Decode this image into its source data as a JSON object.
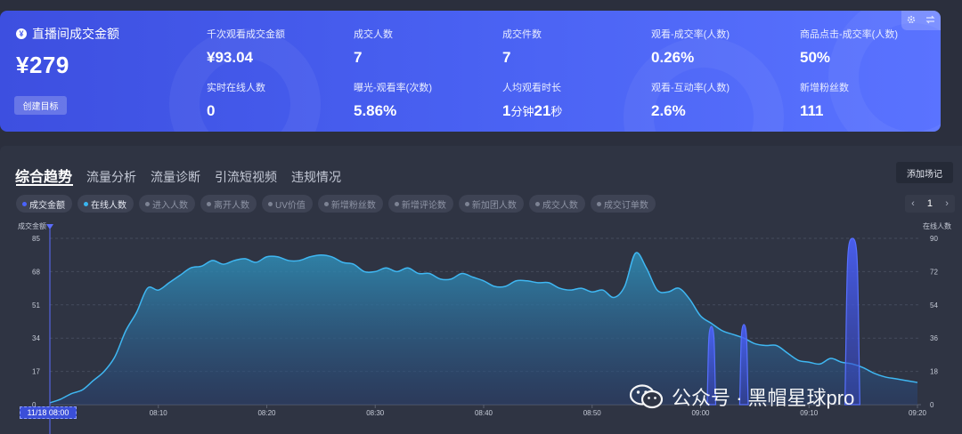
{
  "summary": {
    "main_label": "直播间成交金额",
    "main_badge": "¥",
    "main_value": "¥279",
    "goal_button": "创建目标",
    "stats": [
      {
        "label": "千次观看成交金额",
        "value": "¥93.04"
      },
      {
        "label": "成交人数",
        "value": "7"
      },
      {
        "label": "成交件数",
        "value": "7"
      },
      {
        "label": "观看-成交率(人数)",
        "value": "0.26%"
      },
      {
        "label": "商品点击-成交率(人数)",
        "value": "50%"
      },
      {
        "label": "实时在线人数",
        "value": "0"
      },
      {
        "label": "曝光-观看率(次数)",
        "value": "5.86%"
      },
      {
        "label": "人均观看时长",
        "value_parts": [
          "1",
          "分钟",
          "21",
          "秒"
        ]
      },
      {
        "label": "观看-互动率(人数)",
        "value": "2.6%"
      },
      {
        "label": "新增粉丝数",
        "value": "111"
      }
    ],
    "corner_icons": [
      "gear-icon",
      "swap-icon"
    ]
  },
  "tabs": [
    "综合趋势",
    "流量分析",
    "流量诊断",
    "引流短视频",
    "违规情况"
  ],
  "add_note_button": "添加场记",
  "chips": [
    {
      "label": "成交金额",
      "active": true,
      "color": "#4a63ff"
    },
    {
      "label": "在线人数",
      "active": true,
      "color": "#39b5f0"
    },
    {
      "label": "进入人数",
      "active": false
    },
    {
      "label": "离开人数",
      "active": false
    },
    {
      "label": "UV价值",
      "active": false
    },
    {
      "label": "新增粉丝数",
      "active": false
    },
    {
      "label": "新增评论数",
      "active": false
    },
    {
      "label": "新加团人数",
      "active": false
    },
    {
      "label": "成交人数",
      "active": false
    },
    {
      "label": "成交订单数",
      "active": false
    }
  ],
  "pager": {
    "prev": "‹",
    "page": "1",
    "next": "›"
  },
  "chart_data": {
    "type": "area",
    "left_axis_label": "成交金额",
    "right_axis_label": "在线人数",
    "left_ticks": [
      "85",
      "68",
      "51",
      "34",
      "17",
      "0"
    ],
    "right_ticks": [
      "90",
      "72",
      "54",
      "36",
      "18",
      "0"
    ],
    "ylim_left": [
      0,
      85
    ],
    "ylim_right": [
      0,
      90
    ],
    "x_ticks": [
      "08:10",
      "08:20",
      "08:30",
      "08:40",
      "08:50",
      "09:00",
      "09:10",
      "09:20"
    ],
    "start_label": "11/18 08:00",
    "series": [
      {
        "name": "在线人数",
        "axis": "right",
        "minutes": [
          0,
          1,
          2,
          3,
          4,
          5,
          6,
          7,
          8,
          9,
          10,
          11,
          12,
          13,
          14,
          15,
          16,
          17,
          18,
          19,
          20,
          21,
          22,
          23,
          24,
          25,
          26,
          27,
          28,
          29,
          30,
          31,
          32,
          33,
          34,
          35,
          36,
          37,
          38,
          39,
          40,
          41,
          42,
          43,
          44,
          45,
          46,
          47,
          48,
          49,
          50,
          51,
          52,
          53,
          54,
          55,
          56,
          57,
          58,
          59,
          60,
          61,
          62,
          63,
          64,
          65,
          66,
          67,
          68,
          69,
          70,
          71,
          72,
          73,
          74,
          75,
          76,
          77,
          78,
          79,
          80
        ],
        "values": [
          1,
          3,
          6,
          8,
          13,
          18,
          26,
          40,
          50,
          63,
          62,
          66,
          70,
          74,
          75,
          78,
          76,
          78,
          79,
          77,
          80,
          80,
          78,
          78,
          80,
          81,
          80,
          77,
          76,
          72,
          72,
          74,
          72,
          74,
          71,
          71,
          68,
          68,
          71,
          69,
          67,
          64,
          64,
          67,
          67,
          66,
          66,
          63,
          62,
          63,
          61,
          62,
          58,
          64,
          82,
          74,
          62,
          61,
          63,
          57,
          48,
          44,
          40,
          38,
          36,
          33,
          32,
          32,
          28,
          24,
          23,
          22,
          25,
          23,
          22,
          20,
          17,
          15,
          14,
          13,
          12
        ]
      },
      {
        "name": "成交金额",
        "axis": "left",
        "spikes": [
          {
            "minute": 61,
            "value": 40
          },
          {
            "minute": 64,
            "value": 41
          },
          {
            "minute": 74,
            "value": 85
          }
        ]
      }
    ]
  },
  "watermark": "公众号 · 黑帽星球pro",
  "watermark_icon": "wechat-icon"
}
